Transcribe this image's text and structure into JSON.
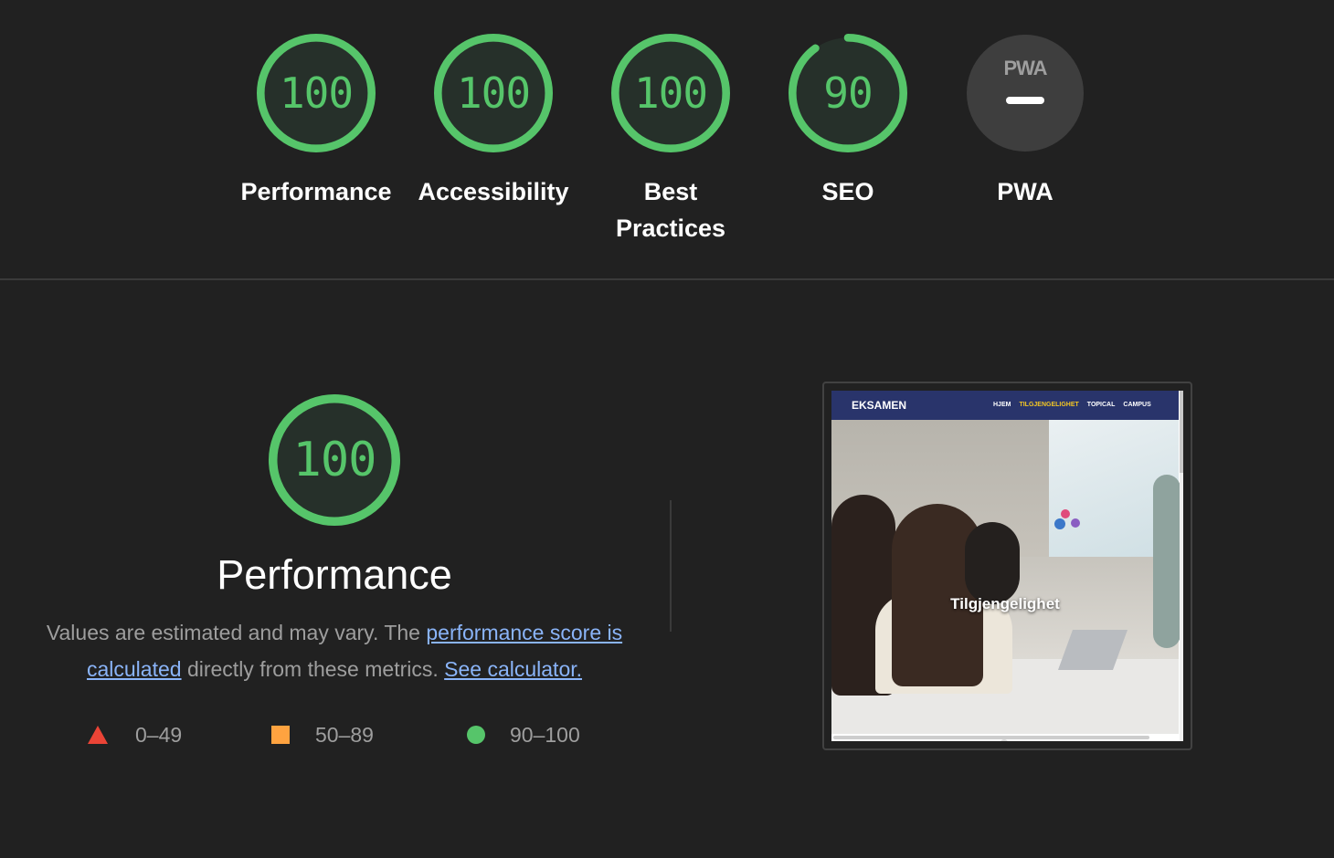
{
  "gauges": [
    {
      "label": "Performance",
      "score": "100",
      "value": 100
    },
    {
      "label": "Accessibility",
      "score": "100",
      "value": 100
    },
    {
      "label": "Best Practices",
      "score": "100",
      "value": 100
    },
    {
      "label": "SEO",
      "score": "90",
      "value": 90
    }
  ],
  "pwa": {
    "logo": "PWA",
    "label": "PWA"
  },
  "category": {
    "score": "100",
    "value": 100,
    "title": "Performance",
    "desc_prefix": "Values are estimated and may vary. The ",
    "desc_link": "performance score is calculated",
    "desc_middle": " directly from these metrics. ",
    "desc_calc_link": "See calculator."
  },
  "legend": [
    {
      "range": "0–49",
      "shape": "triangle",
      "color": "#eb4436"
    },
    {
      "range": "50–89",
      "shape": "square",
      "color": "#ffa340"
    },
    {
      "range": "90–100",
      "shape": "circle",
      "color": "#56c56a"
    }
  ],
  "screenshot": {
    "brand": "EKSAMEN",
    "nav": [
      "HJEM",
      "TILGJENGELIGHET",
      "TOPICAL",
      "CAMPUS"
    ],
    "active_nav": "TILGJENGELIGHET",
    "caption": "Tilgjengelighet"
  },
  "colors": {
    "pass": "#56c56a",
    "pass_bg": "#26302a",
    "background": "#212121",
    "link": "#8ab4f8"
  }
}
